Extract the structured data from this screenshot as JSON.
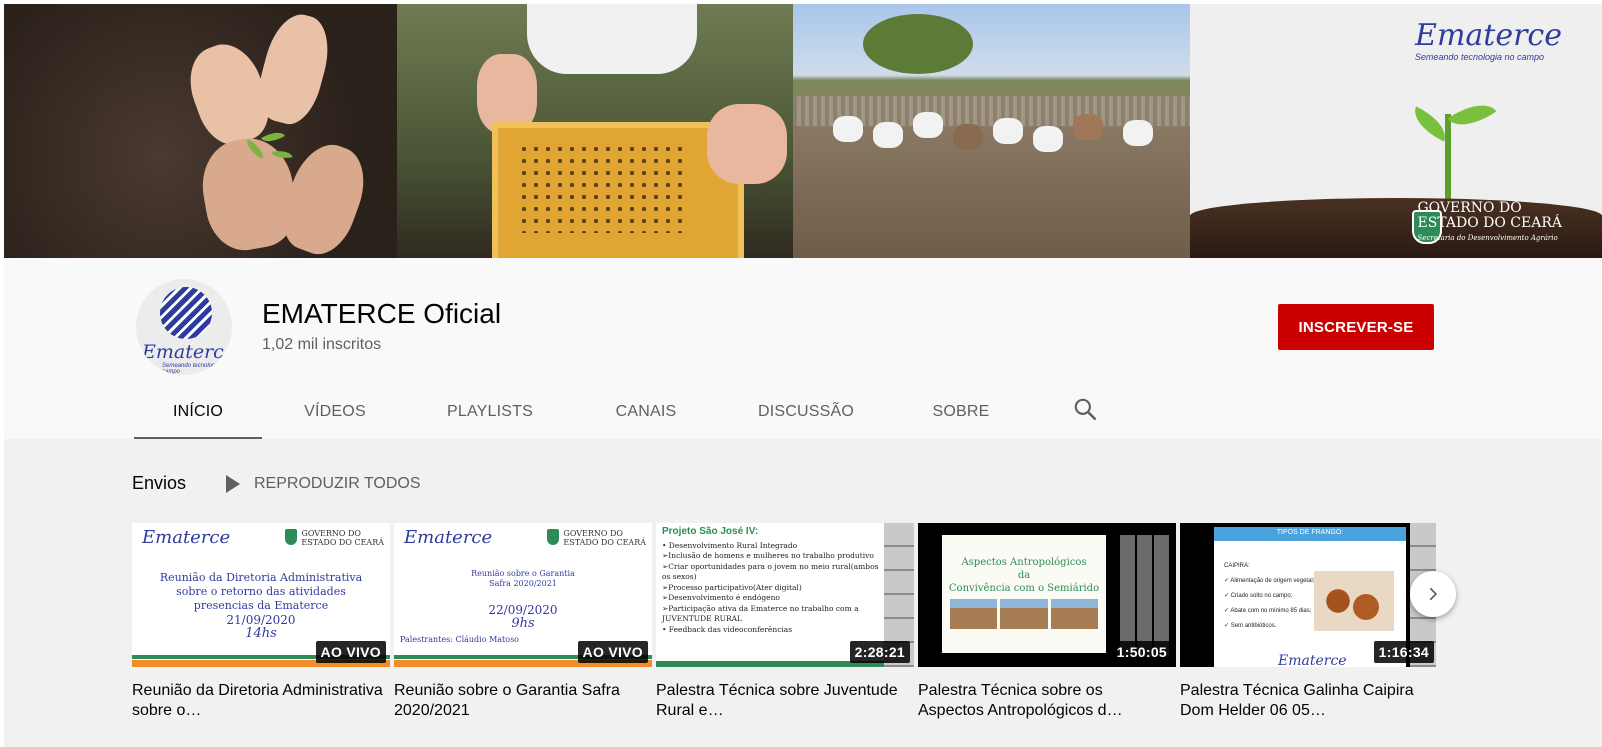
{
  "banner": {
    "brand_logo": "Ematerce",
    "brand_tagline": "Semeando tecnologia no campo",
    "gov_line1": "GOVERNO DO",
    "gov_line2": "ESTADO DO CEARÁ",
    "gov_line3": "Secretaria do Desenvolvimento Agrário"
  },
  "channel": {
    "avatar_logo": "Ematerce",
    "avatar_tagline": "Semeando tecnologia no campo",
    "name": "EMATERCE Oficial",
    "subscribers": "1,02 mil inscritos",
    "subscribe_label": "INSCREVER-SE",
    "subscribe_color": "#cc0000"
  },
  "tabs": [
    {
      "label": "INÍCIO",
      "active": true
    },
    {
      "label": "VÍDEOS",
      "active": false
    },
    {
      "label": "PLAYLISTS",
      "active": false
    },
    {
      "label": "CANAIS",
      "active": false
    },
    {
      "label": "DISCUSSÃO",
      "active": false
    },
    {
      "label": "SOBRE",
      "active": false
    }
  ],
  "search_icon": "search-icon",
  "shelf": {
    "title": "Envios",
    "play_all_label": "REPRODUZIR TODOS"
  },
  "videos": [
    {
      "title": "Reunião da Diretoria Administrativa sobre o…",
      "badge": "AO VIVO",
      "slide": {
        "logo": "Ematerce",
        "gov": "GOVERNO DO\nESTADO DO CEARÁ",
        "heading": "Reunião da Diretoria Administrativa sobre o retorno das atividades presencias da Ematerce",
        "date": "21/09/2020",
        "time": "14hs"
      }
    },
    {
      "title": "Reunião sobre o Garantia Safra 2020/2021",
      "badge": "AO VIVO",
      "slide": {
        "logo": "Ematerce",
        "gov": "GOVERNO DO\nESTADO DO CEARÁ",
        "heading": "Reunião sobre o Garantia Safra 2020/2021",
        "date": "22/09/2020",
        "time": "9hs",
        "speakers": "Palestrantes: Cláudio Matoso"
      }
    },
    {
      "title": "Palestra Técnica sobre Juventude Rural e…",
      "badge": "2:28:21",
      "slide": {
        "heading": "Projeto São José IV:",
        "bullets": [
          "• Desenvolvimento Rural Integrado",
          "  ➢Inclusão de homens e mulheres no trabalho produtivo",
          "  ➢Criar oportunidades para o jovem no meio rural(ambos os sexos)",
          "  ➢Processo participativo(Ater digital)",
          "  ➢Desenvolvimento é endógeno",
          "  ➢Participação ativa da Ematerce no trabalho com a JUVENTUDE RURAL",
          "• Feedback das videoconferências"
        ]
      }
    },
    {
      "title": "Palestra Técnica sobre os Aspectos Antropológicos d…",
      "badge": "1:50:05",
      "slide": {
        "heading1": "Aspectos Antropológicos",
        "heading2": "da",
        "heading3": "Convivência com o Semiárido"
      }
    },
    {
      "title": "Palestra Técnica Galinha Caipira Dom Helder 06 05…",
      "badge": "1:16:34",
      "slide": {
        "heading": "TIPOS DE FRANGO:",
        "subheading": "CAIPIRA:",
        "items": [
          "✓ Alimentação de origem vegetal;",
          "✓ Criado solto no campo;",
          "✓ Abate com no mínimo 85 dias;",
          "✓ Sem antibióticos."
        ],
        "logo": "Ematerce"
      }
    }
  ],
  "next_icon": "chevron-right-icon"
}
